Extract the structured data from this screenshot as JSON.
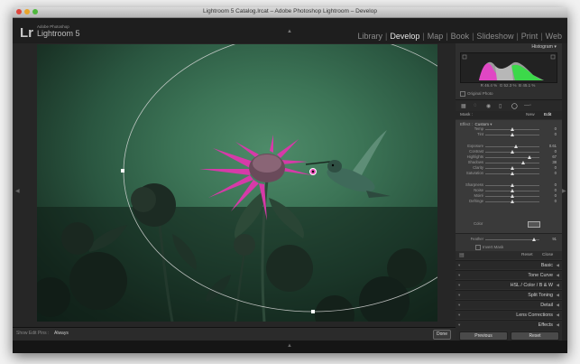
{
  "window": {
    "title": "Lightroom 5 Catalog.lrcat – Adobe Photoshop Lightroom – Develop"
  },
  "identity": {
    "logo": "Lr",
    "company": "Adobe Photoshop",
    "product": "Lightroom 5"
  },
  "modules": [
    {
      "label": "Library",
      "active": false
    },
    {
      "label": "Develop",
      "active": true
    },
    {
      "label": "Map",
      "active": false
    },
    {
      "label": "Book",
      "active": false
    },
    {
      "label": "Slideshow",
      "active": false
    },
    {
      "label": "Print",
      "active": false
    },
    {
      "label": "Web",
      "active": false
    }
  ],
  "toolbar": {
    "show_edit_pins_label": "Show Edit Pins :",
    "show_edit_pins_value": "Always",
    "done_label": "Done"
  },
  "histogram": {
    "title": "Histogram",
    "readout": {
      "r_label": "R",
      "r": "46.4",
      "g_label": "G",
      "g": "52.3",
      "b_label": "B",
      "b": "45.1",
      "unit": "%"
    },
    "original_photo_label": "Original Photo"
  },
  "mask": {
    "label": "Mask :",
    "new_label": "New",
    "edit_label": "Edit"
  },
  "effect": {
    "label": "Effect :",
    "value": "Custom"
  },
  "sliders": [
    {
      "label": "Temp",
      "value": "0",
      "pos": 0.5
    },
    {
      "label": "Tint",
      "value": "0",
      "pos": 0.5
    },
    {
      "label": "Exposure",
      "value": "0.61",
      "pos": 0.58
    },
    {
      "label": "Contrast",
      "value": "0",
      "pos": 0.5
    },
    {
      "label": "Highlights",
      "value": "67",
      "pos": 0.82
    },
    {
      "label": "Shadows",
      "value": "38",
      "pos": 0.7
    },
    {
      "label": "Clarity",
      "value": "0",
      "pos": 0.5
    },
    {
      "label": "Saturation",
      "value": "0",
      "pos": 0.5
    },
    {
      "label": "Sharpness",
      "value": "0",
      "pos": 0.5
    },
    {
      "label": "Noise",
      "value": "0",
      "pos": 0.5
    },
    {
      "label": "Moiré",
      "value": "0",
      "pos": 0.5
    },
    {
      "label": "Defringe",
      "value": "0",
      "pos": 0.5
    }
  ],
  "color_label": "Color",
  "feather": {
    "label": "Feather",
    "value": "91",
    "pos": 0.91,
    "invert_mask_label": "Invert Mask"
  },
  "reset_label": "Reset",
  "close_label": "Close",
  "sections": [
    {
      "label": "Basic"
    },
    {
      "label": "Tone Curve"
    },
    {
      "label": "HSL / Color / B & W"
    },
    {
      "label": "Split Toning"
    },
    {
      "label": "Detail"
    },
    {
      "label": "Lens Corrections"
    },
    {
      "label": "Effects"
    }
  ],
  "buttons": {
    "previous": "Previous",
    "reset": "Reset"
  },
  "colors": {
    "accent": "#e6e6e6",
    "histo_magenta": "#e047c4",
    "histo_green": "#3cd94a"
  }
}
